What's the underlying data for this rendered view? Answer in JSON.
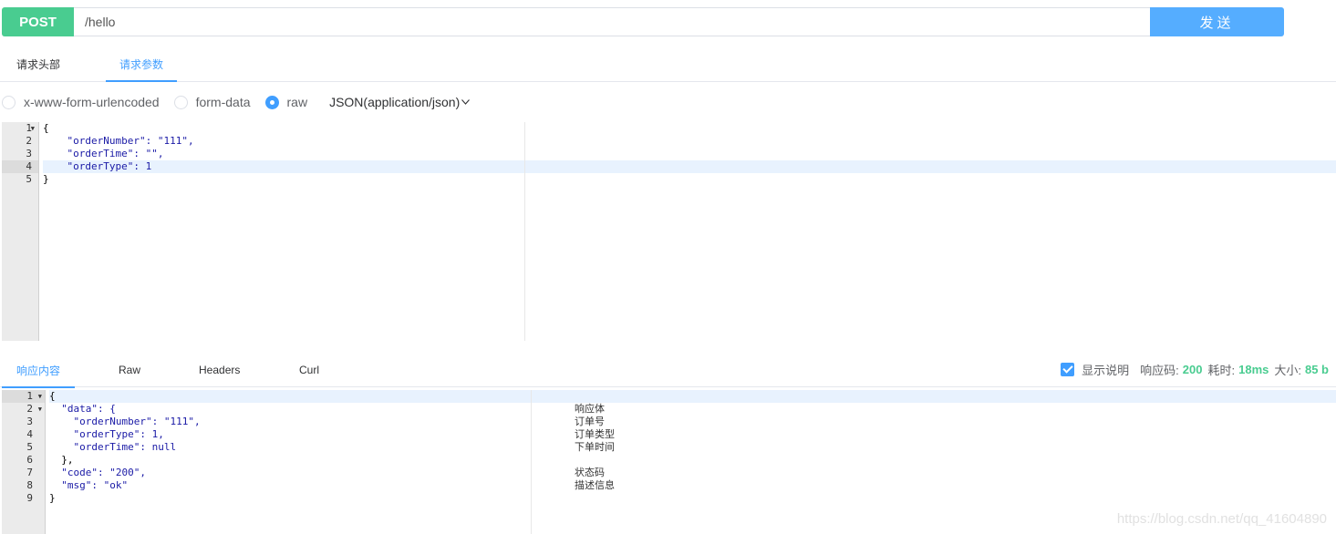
{
  "request": {
    "method": "POST",
    "url": "/hello",
    "send_label": "发送"
  },
  "request_tabs": [
    "请求头部",
    "请求参数"
  ],
  "body_types": [
    {
      "label": "x-www-form-urlencoded",
      "checked": false
    },
    {
      "label": "form-data",
      "checked": false
    },
    {
      "label": "raw",
      "checked": true
    }
  ],
  "content_type": "JSON(application/json)",
  "request_body": {
    "line_numbers": [
      "1",
      "2",
      "3",
      "4",
      "5"
    ],
    "lines": [
      "{",
      "    \"orderNumber\": \"111\",",
      "    \"orderTime\": \"\",",
      "    \"orderType\": 1",
      "}"
    ],
    "highlighted_line": 4
  },
  "response_tabs": [
    "响应内容",
    "Raw",
    "Headers",
    "Curl"
  ],
  "response_status": {
    "show_desc_label": "显示说明",
    "show_desc_checked": true,
    "code_label": "响应码:",
    "code_value": "200",
    "time_label": "耗时:",
    "time_value": "18ms",
    "size_label": "大小:",
    "size_value": "85 b"
  },
  "response_body": {
    "line_numbers": [
      "1",
      "2",
      "3",
      "4",
      "5",
      "6",
      "7",
      "8",
      "9"
    ],
    "lines": [
      "{",
      "  \"data\": {",
      "    \"orderNumber\": \"111\",",
      "    \"orderType\": 1,",
      "    \"orderTime\": null",
      "  },",
      "  \"code\": \"200\",",
      "  \"msg\": \"ok\"",
      "}"
    ],
    "descriptions": [
      "响应体",
      "订单号",
      "订单类型",
      "下单时间",
      "",
      "状态码",
      "描述信息"
    ]
  },
  "watermark": "https://blog.csdn.net/qq_41604890",
  "colors": {
    "method_bg": "#49cc90",
    "send_bg": "#55adff",
    "accent": "#409eff",
    "status_green": "#49cc90"
  }
}
